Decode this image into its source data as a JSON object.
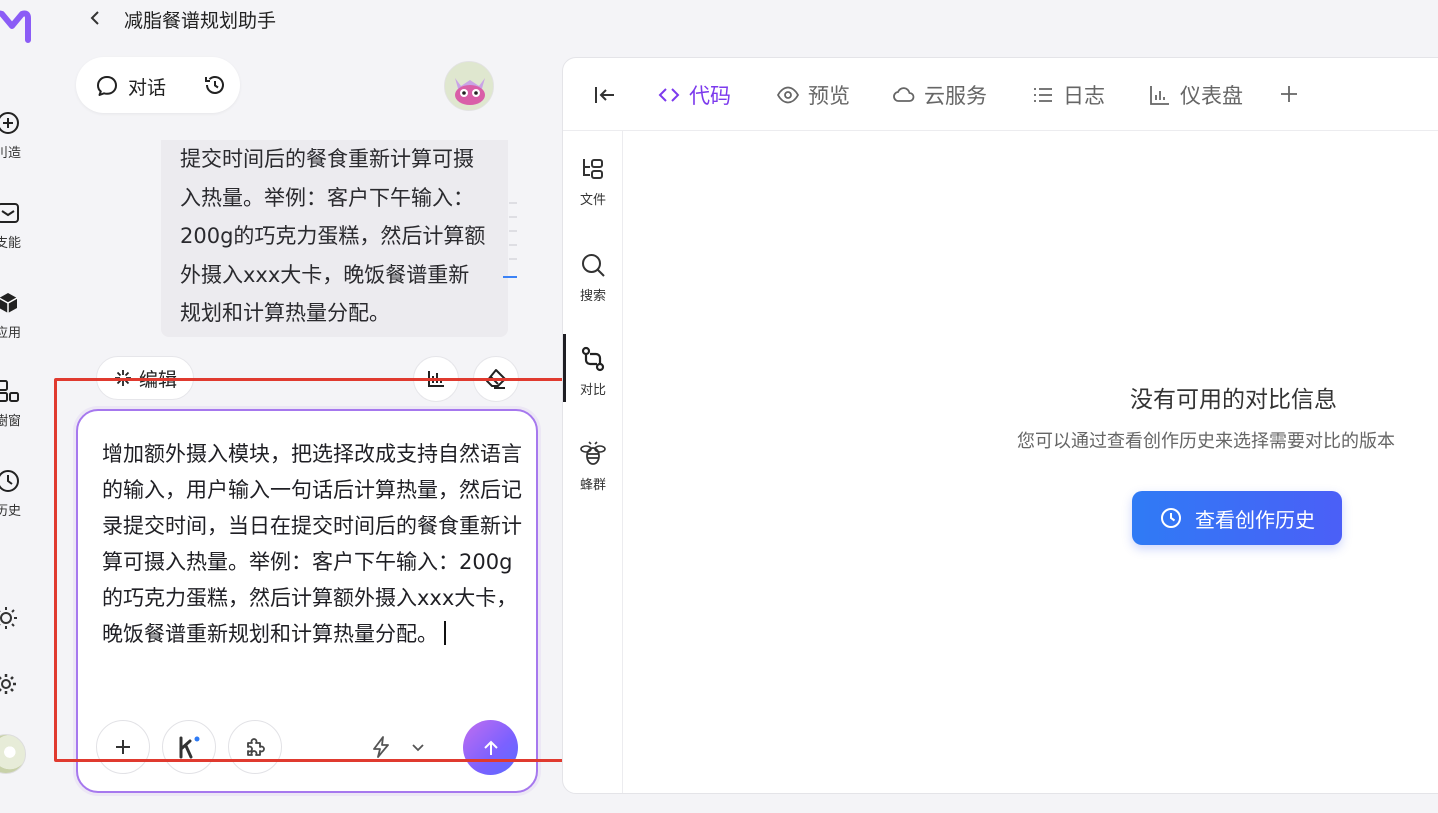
{
  "header": {
    "back_icon": "chevron-left-icon",
    "title": "减脂餐谱规划助手"
  },
  "rail": {
    "items": [
      {
        "label": "创造",
        "visible_label": "刂造",
        "icon": "plus-circle-icon"
      },
      {
        "label": "技能",
        "visible_label": "支能",
        "icon": "inbox-icon"
      },
      {
        "label": "应用",
        "visible_label": "应用",
        "icon": "cube-icon"
      },
      {
        "label": "橱窗",
        "visible_label": "樹窗",
        "icon": "layout-icon"
      },
      {
        "label": "历史",
        "visible_label": "历史",
        "icon": "clock-icon"
      }
    ]
  },
  "chat": {
    "tab_label": "对话",
    "message_text": "提交时间后的餐食重新计算可摄入热量。举例：客户下午输入：200g的巧克力蛋糕，然后计算额外摄入xxx大卡，晚饭餐谱重新规划和计算热量分配。",
    "edit_label": "编辑"
  },
  "composer": {
    "text": "增加额外摄入模块，把选择改成支持自然语言的输入，用户输入一句话后计算热量，然后记录提交时间，当日在提交时间后的餐食重新计算可摄入热量。举例：客户下午输入：200g的巧克力蛋糕，然后计算额外摄入xxx大卡，晚饭餐谱重新规划和计算热量分配。"
  },
  "panel": {
    "tabs": [
      {
        "label": "代码",
        "icon": "code-brackets-icon",
        "active": true
      },
      {
        "label": "预览",
        "icon": "eye-icon",
        "active": false
      },
      {
        "label": "云服务",
        "icon": "cloud-icon",
        "active": false
      },
      {
        "label": "日志",
        "icon": "list-icon",
        "active": false
      },
      {
        "label": "仪表盘",
        "icon": "bar-chart-icon",
        "active": false
      }
    ],
    "side_tools": [
      {
        "label": "文件",
        "icon": "file-tree-icon"
      },
      {
        "label": "搜索",
        "icon": "search-icon"
      },
      {
        "label": "对比",
        "icon": "diff-icon",
        "active": true
      },
      {
        "label": "蜂群",
        "icon": "bee-icon"
      }
    ],
    "empty_title": "没有可用的对比信息",
    "empty_subtitle": "您可以通过查看创作历史来选择需要对比的版本",
    "history_button": "查看创作历史"
  },
  "colors": {
    "accent_purple": "#7c3aed",
    "composer_border": "#a678ee",
    "primary_blue": "#2f7bf5",
    "annotation_red": "#e03a2f"
  }
}
